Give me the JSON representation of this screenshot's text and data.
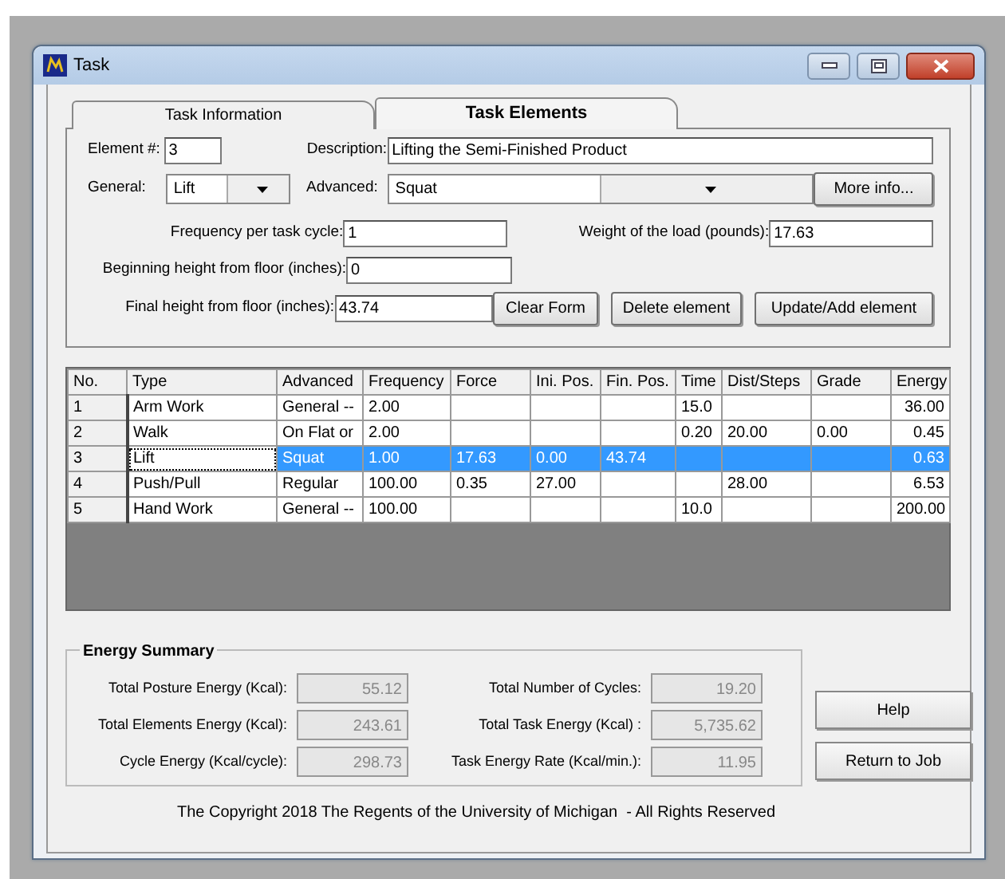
{
  "window": {
    "title": "Task"
  },
  "tabs": [
    {
      "label": "Task Information",
      "selected": false
    },
    {
      "label": "Task Elements",
      "selected": true
    }
  ],
  "form": {
    "element_label": "Element #:",
    "element_value": "3",
    "description_label": "Description:",
    "description_value": "Lifting the Semi-Finished Product",
    "general_label": "General:",
    "general_value": "Lift",
    "advanced_label": "Advanced:",
    "advanced_value": "Squat",
    "more_info": "More info...",
    "frequency_label": "Frequency per task cycle:",
    "frequency_value": "1",
    "weight_label": "Weight of the load (pounds):",
    "weight_value": "17.63",
    "begin_label": "Beginning height from floor (inches):",
    "begin_value": "0",
    "final_label": "Final height from floor (inches):",
    "final_value": "43.74",
    "buttons": [
      "Clear Form",
      "Delete element",
      "Update/Add element"
    ]
  },
  "table": {
    "columns": [
      "No.",
      "Type",
      "Advanced",
      "Frequency",
      "Force",
      "Ini. Pos.",
      "Fin. Pos.",
      "Time",
      "Dist/Steps",
      "Grade",
      "Energy"
    ],
    "rows": [
      {
        "selected": false,
        "cells": [
          "1",
          "Arm Work",
          "General --",
          "2.00",
          "",
          "",
          "",
          "15.0",
          "",
          "",
          "36.00"
        ]
      },
      {
        "selected": false,
        "cells": [
          "2",
          "Walk",
          "On Flat or",
          "2.00",
          "",
          "",
          "",
          "0.20",
          "20.00",
          "0.00",
          "0.45"
        ]
      },
      {
        "selected": true,
        "cells": [
          "3",
          "Lift",
          "Squat",
          "1.00",
          "17.63",
          "0.00",
          "43.74",
          "",
          "",
          "",
          "0.63"
        ]
      },
      {
        "selected": false,
        "cells": [
          "4",
          "Push/Pull",
          "Regular",
          "100.00",
          "0.35",
          "27.00",
          "",
          "",
          "28.00",
          "",
          "6.53"
        ]
      },
      {
        "selected": false,
        "cells": [
          "5",
          "Hand Work",
          "General --",
          "100.00",
          "",
          "",
          "",
          "10.0",
          "",
          "",
          "200.00"
        ]
      }
    ]
  },
  "energy_summary": {
    "title": "Energy Summary",
    "left": [
      {
        "label": "Total Posture Energy (Kcal):",
        "value": "55.12"
      },
      {
        "label": "Total Elements Energy (Kcal):",
        "value": "243.61"
      },
      {
        "label": "Cycle Energy (Kcal/cycle):",
        "value": "298.73"
      }
    ],
    "right": [
      {
        "label": "Total Number of Cycles:",
        "value": "19.20"
      },
      {
        "label": "Total Task Energy (Kcal) :",
        "value": "5,735.62"
      },
      {
        "label": "Task Energy Rate (Kcal/min.):",
        "value": "11.95"
      }
    ]
  },
  "side_buttons": [
    "Help",
    "Return to Job"
  ],
  "copyright": "The Copyright 2018 The Regents of the University of Michigan  - All Rights Reserved"
}
